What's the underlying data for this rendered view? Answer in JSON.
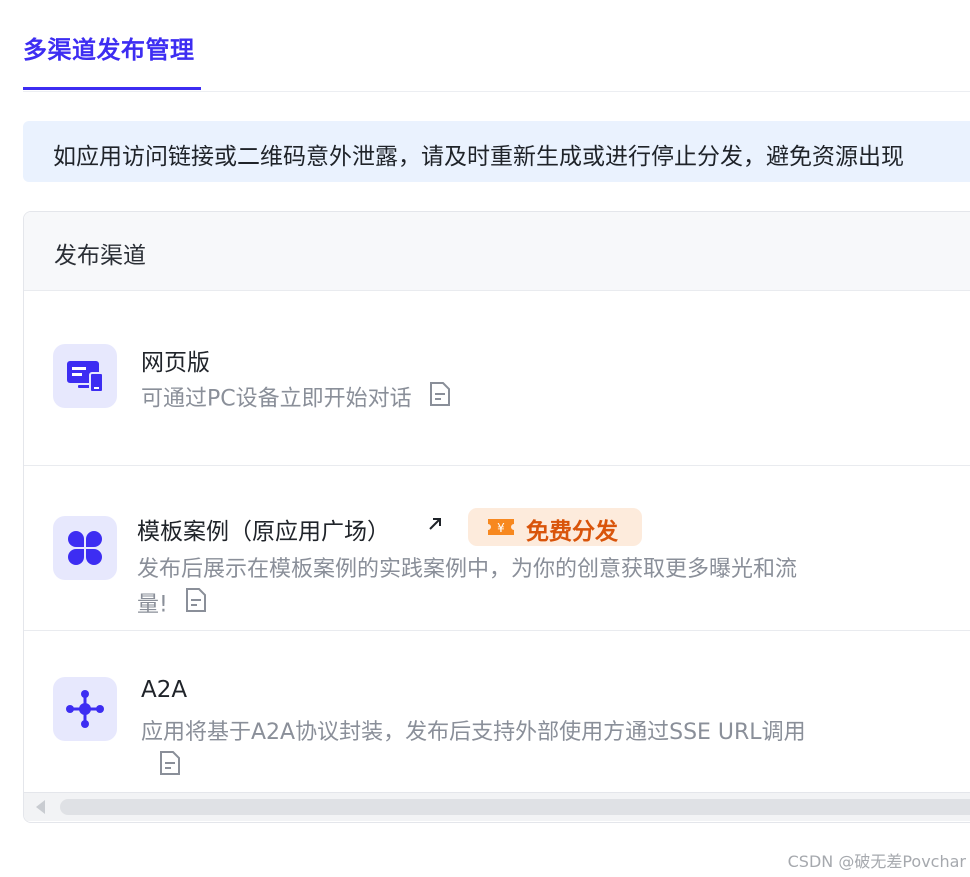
{
  "tabs": {
    "active_label": "多渠道发布管理"
  },
  "notice": {
    "text": "如应用访问链接或二维码意外泄露，请及时重新生成或进行停止分发，避免资源出现"
  },
  "panel": {
    "header": "发布渠道",
    "channels": [
      {
        "title": "网页版",
        "description": "可通过PC设备立即开始对话",
        "icon": "monitor-icon"
      },
      {
        "title": "模板案例（原应用广场）",
        "description_line1": "发布后展示在模板案例的实践案例中，为你的创意获取更多曝光和流",
        "description_line2": "量!",
        "badge": "免费分发",
        "icon": "grid-clover-icon"
      },
      {
        "title": "A2A",
        "description": "应用将基于A2A协议封装，发布后支持外部使用方通过SSE URL调用",
        "icon": "network-node-icon"
      }
    ]
  },
  "watermark": "CSDN @破无差Povchar",
  "colors": {
    "accent": "#3d2df2",
    "badge_text": "#d9540a",
    "badge_bg": "#fdebdc",
    "notice_bg": "#eaf2fe"
  }
}
